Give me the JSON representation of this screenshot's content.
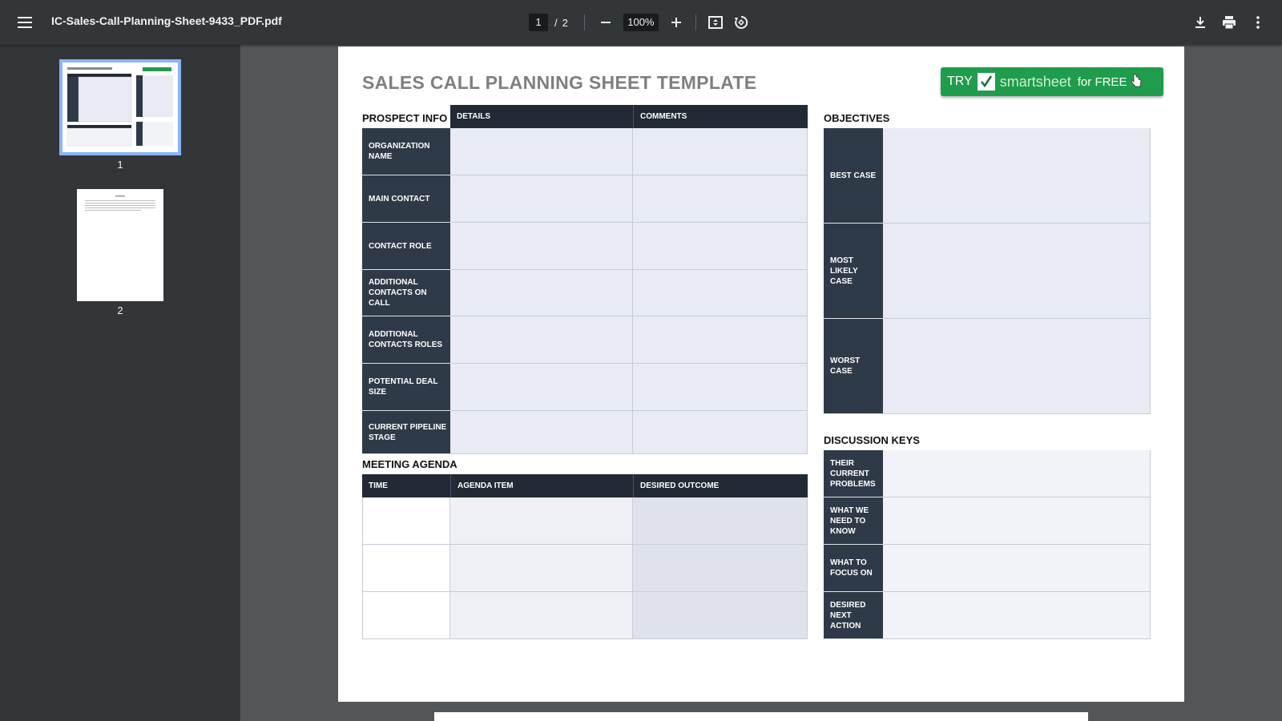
{
  "toolbar": {
    "file_name": "IC-Sales-Call-Planning-Sheet-9433_PDF.pdf",
    "current_page": "1",
    "page_separator": "/",
    "total_pages": "2",
    "zoom": "100%"
  },
  "sidebar": {
    "thumbnails": [
      {
        "label": "1"
      },
      {
        "label": "2"
      }
    ]
  },
  "document": {
    "title": "SALES CALL PLANNING SHEET TEMPLATE",
    "promo": {
      "try": "TRY",
      "brand": "smartsheet",
      "free": "for FREE"
    },
    "prospect": {
      "section_label": "PROSPECT INFO",
      "col_details": "DETAILS",
      "col_comments": "COMMENTS",
      "rows": [
        "ORGANIZATION NAME",
        "MAIN CONTACT",
        "CONTACT ROLE",
        "ADDITIONAL CONTACTS ON CALL",
        "ADDITIONAL CONTACTS ROLES",
        "POTENTIAL DEAL SIZE",
        "CURRENT PIPELINE STAGE"
      ]
    },
    "agenda": {
      "section_label": "MEETING AGENDA",
      "col_time": "TIME",
      "col_item": "AGENDA ITEM",
      "col_outcome": "DESIRED OUTCOME"
    },
    "objectives": {
      "section_label": "OBJECTIVES",
      "rows": [
        "BEST CASE",
        "MOST LIKELY CASE",
        "WORST CASE"
      ]
    },
    "discussion": {
      "section_label": "DISCUSSION KEYS",
      "rows": [
        "THEIR CURRENT PROBLEMS",
        "WHAT WE NEED TO KNOW",
        "WHAT TO FOCUS ON",
        "DESIRED NEXT ACTION"
      ]
    }
  },
  "icons": {
    "menu": "menu-icon",
    "zoom_out": "minus-icon",
    "zoom_in": "plus-icon",
    "fit": "fit-to-page-icon",
    "rotate": "rotate-icon",
    "download": "download-icon",
    "print": "print-icon",
    "more": "more-vert-icon"
  },
  "colors": {
    "toolbar_bg": "#323639",
    "viewer_bg": "#525659",
    "table_header": "#222a35",
    "row_label": "#2f3a48",
    "cell_fill": "#e8ebf3",
    "promo_green": "#1f9d4c",
    "thumb_selected": "#8ab4f8"
  }
}
